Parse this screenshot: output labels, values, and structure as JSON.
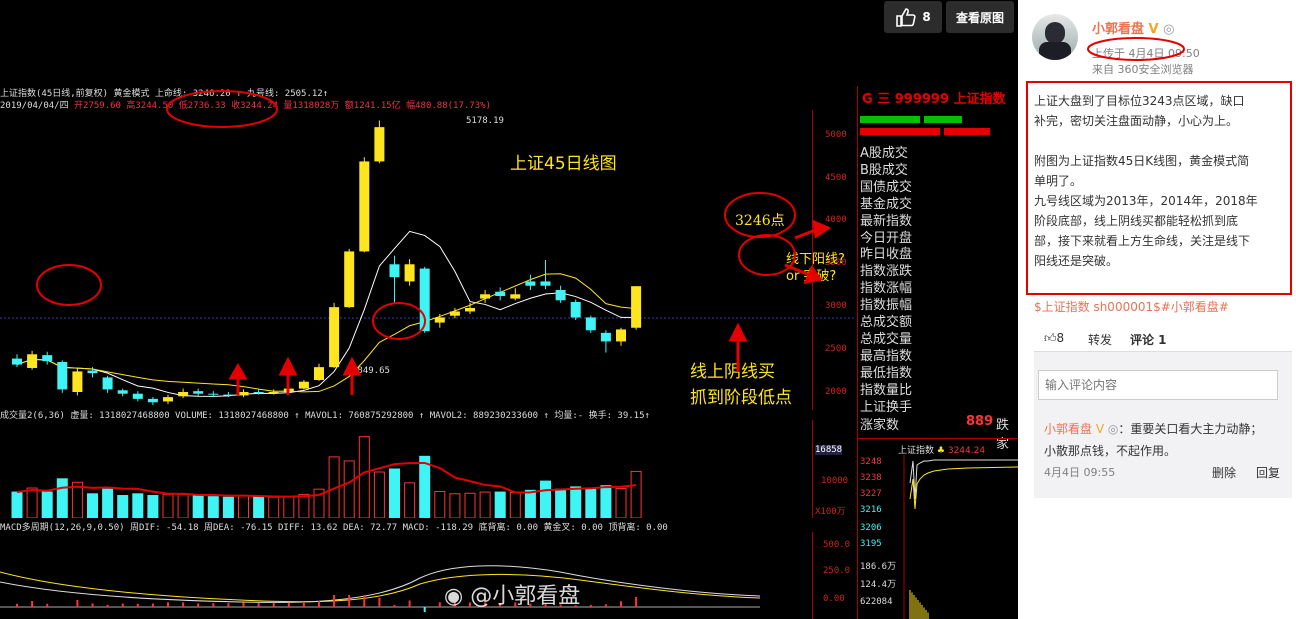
{
  "toolbar": {
    "like_icon": "thumbs-up-icon",
    "like_count": "8",
    "view_original": "查看原图"
  },
  "chart_header": {
    "line1": "上证指数(45日线,前复权) 黄金模式 上命线: 3246.20 ↑ 九号线: 2505.12↑",
    "line2_date": "2019/04/04/四",
    "line2_rest": "开2759.60 高3244.50 低2736.33 收3244.24 量1318028万 额1241.15亿",
    "line2_change": "幅480.88(17.73%)"
  },
  "chart_annotations": {
    "title": "上证45日线图",
    "target_point": "3246点",
    "question_line1": "线下阳线?",
    "question_line2": "or 突破?",
    "buy_line1": "线上阴线买",
    "buy_line2": "抓到阶段低点",
    "high_label": "5178.19",
    "low_label": "1849.65"
  },
  "price_axis": [
    "5000",
    "4500",
    "4000",
    "3500",
    "3000",
    "2500",
    "2000"
  ],
  "volume_header": "成交量2(6,36) 虚量: 1318027468800 VOLUME: 1318027468800 ↑ MAVOL1: 760875292800 ↑ MAVOL2: 889230233600 ↑ 均量:- 换手: 39.15↑",
  "volume_axis": [
    "16858",
    "10000",
    "X100万"
  ],
  "macd_header": "MACD多周期(12,26,9,0.50) 周DIF: -54.18 周DEA: -76.15 DIFF: 13.62 DEA: 72.77 MACD: -118.29 底背离: 0.00 黄金叉: 0.00 顶背离: 0.00",
  "macd_axis": [
    "500.0",
    "250.0",
    "0.00"
  ],
  "watermark": "@小郭看盘",
  "side_panel": {
    "code_line": "G 三 999999 上证指数",
    "menu": [
      "A股成交",
      "B股成交",
      "国债成交",
      "基金成交",
      "最新指数",
      "今日开盘",
      "昨日收盘",
      "指数涨跌",
      "指数涨幅",
      "指数振幅",
      "总成交额",
      "总成交量",
      "最高指数",
      "最低指数",
      "指数量比",
      "上证换手"
    ],
    "rise_label": "涨家数",
    "rise_value": "889",
    "fall_label": "跌家",
    "mini_title": "上证指数",
    "mini_value": "3244.24",
    "mini_axis": [
      "3248",
      "3238",
      "3227",
      "3216",
      "3206",
      "3195",
      "186.6万",
      "124.4万",
      "622084"
    ]
  },
  "weibo": {
    "user_name": "小郭看盘",
    "post_time_label": "上传于 4月4日 09:50",
    "post_source": "来自 360安全浏览器",
    "post_lines": [
      "上证大盘到了目标位3243点区域，缺口",
      "补完，密切关注盘面动静，小心为上。",
      "",
      "附图为上证指数45日K线图，黄金模式简",
      "单明了。",
      "九号线区域为2013年，2014年，2018年",
      "阶段底部，线上阴线买都能轻松抓到底",
      "部，接下来就看上方生命线，关注是线下",
      "阳线还是突破。"
    ],
    "topic_link": "$上证指数 sh000001$#小郭看盘#",
    "action_like_count": "8",
    "action_forward": "转发",
    "action_comment": "评论 1",
    "comment_placeholder": "输入评论内容",
    "comment_user": "小郭看盘",
    "comment_text_1": "：重要关口看大主力动静；",
    "comment_text_2": "小散那点钱，不起作用。",
    "comment_time": "4月4日 09:55",
    "comment_delete": "删除",
    "comment_reply": "回复"
  },
  "chart_data": {
    "type": "candlestick",
    "title": "上证45日线图",
    "y_range": [
      1800,
      5300
    ],
    "candles": [
      {
        "o": 2400,
        "c": 2330,
        "h": 2450,
        "l": 2300
      },
      {
        "o": 2290,
        "c": 2450,
        "h": 2490,
        "l": 2270
      },
      {
        "o": 2440,
        "c": 2370,
        "h": 2480,
        "l": 2330
      },
      {
        "o": 2360,
        "c": 2040,
        "h": 2380,
        "l": 2000
      },
      {
        "o": 2010,
        "c": 2250,
        "h": 2290,
        "l": 1970
      },
      {
        "o": 2260,
        "c": 2230,
        "h": 2300,
        "l": 2180
      },
      {
        "o": 2180,
        "c": 2040,
        "h": 2200,
        "l": 2000
      },
      {
        "o": 2030,
        "c": 1990,
        "h": 2050,
        "l": 1960
      },
      {
        "o": 1990,
        "c": 1930,
        "h": 2020,
        "l": 1900
      },
      {
        "o": 1930,
        "c": 1890,
        "h": 1950,
        "l": 1860
      },
      {
        "o": 1900,
        "c": 1950,
        "h": 1980,
        "l": 1870
      },
      {
        "o": 1960,
        "c": 2010,
        "h": 2050,
        "l": 1940
      },
      {
        "o": 2020,
        "c": 1990,
        "h": 2050,
        "l": 1960
      },
      {
        "o": 1990,
        "c": 1980,
        "h": 2020,
        "l": 1950
      },
      {
        "o": 1980,
        "c": 1970,
        "h": 2010,
        "l": 1950
      },
      {
        "o": 1970,
        "c": 2010,
        "h": 2040,
        "l": 1950
      },
      {
        "o": 2010,
        "c": 2000,
        "h": 2050,
        "l": 1980
      },
      {
        "o": 2000,
        "c": 2010,
        "h": 2040,
        "l": 1980
      },
      {
        "o": 2010,
        "c": 2050,
        "h": 2060,
        "l": 1990
      },
      {
        "o": 2050,
        "c": 2130,
        "h": 2150,
        "l": 2040
      },
      {
        "o": 2150,
        "c": 2300,
        "h": 2340,
        "l": 2140
      },
      {
        "o": 2300,
        "c": 3000,
        "h": 3050,
        "l": 2290
      },
      {
        "o": 3000,
        "c": 3650,
        "h": 3680,
        "l": 2990
      },
      {
        "o": 3650,
        "c": 4700,
        "h": 4750,
        "l": 3640
      },
      {
        "o": 4700,
        "c": 5100,
        "h": 5178,
        "l": 4680
      },
      {
        "o": 3500,
        "c": 3350,
        "h": 3600,
        "l": 3050
      },
      {
        "o": 3300,
        "c": 3500,
        "h": 3560,
        "l": 3250
      },
      {
        "o": 3450,
        "c": 2720,
        "h": 3470,
        "l": 2700
      },
      {
        "o": 2820,
        "c": 2880,
        "h": 2920,
        "l": 2760
      },
      {
        "o": 2900,
        "c": 2950,
        "h": 2990,
        "l": 2870
      },
      {
        "o": 2950,
        "c": 2990,
        "h": 3050,
        "l": 2920
      },
      {
        "o": 3100,
        "c": 3150,
        "h": 3200,
        "l": 3050
      },
      {
        "o": 3180,
        "c": 3130,
        "h": 3230,
        "l": 3080
      },
      {
        "o": 3100,
        "c": 3150,
        "h": 3220,
        "l": 3080
      },
      {
        "o": 3300,
        "c": 3250,
        "h": 3380,
        "l": 3200
      },
      {
        "o": 3300,
        "c": 3250,
        "h": 3550,
        "l": 3210
      },
      {
        "o": 3200,
        "c": 3080,
        "h": 3250,
        "l": 3050
      },
      {
        "o": 3060,
        "c": 2880,
        "h": 3090,
        "l": 2850
      },
      {
        "o": 2880,
        "c": 2730,
        "h": 2900,
        "l": 2700
      },
      {
        "o": 2700,
        "c": 2600,
        "h": 2730,
        "l": 2470
      },
      {
        "o": 2600,
        "c": 2740,
        "h": 2760,
        "l": 2550
      },
      {
        "o": 2759.6,
        "c": 3244.24,
        "h": 3244.5,
        "l": 2736.33
      }
    ],
    "volume_ylim": [
      0,
      17000
    ]
  },
  "colors": {
    "up": "#ffe51f",
    "down": "#3ff4f4",
    "accent_red": "#e50000",
    "weibo_orange": "#eb7350"
  }
}
